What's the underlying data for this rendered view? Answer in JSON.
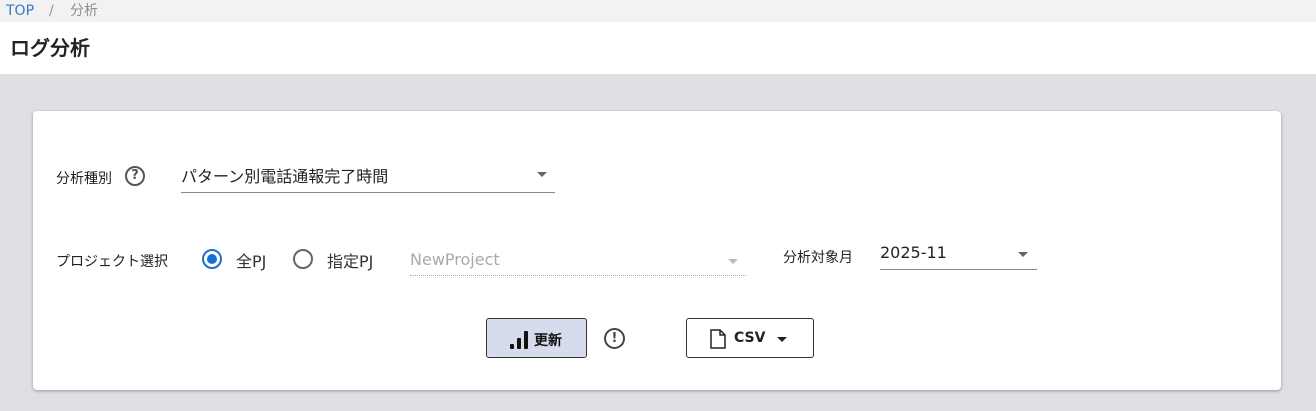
{
  "breadcrumb": {
    "home": "TOP",
    "separator": "/",
    "current": "分析"
  },
  "page": {
    "title": "ログ分析"
  },
  "form": {
    "analysis_type": {
      "label": "分析種別",
      "help_icon": "?",
      "value": "パターン別電話通報完了時間"
    },
    "project": {
      "label": "プロジェクト選択",
      "options": [
        {
          "label": "全PJ",
          "checked": true
        },
        {
          "label": "指定PJ",
          "checked": false
        }
      ],
      "select_value": "NewProject"
    },
    "month": {
      "label": "分析対象月",
      "value": "2025-11"
    }
  },
  "actions": {
    "update_label": "更新",
    "info_icon": "!",
    "csv_label": "CSV"
  },
  "colors": {
    "accent": "#1b6fd1",
    "link": "#2f7bc5",
    "update_button_bg": "#d6dcec"
  },
  "icons": {
    "help": "question-circle-icon",
    "update": "bar-chart-icon",
    "info": "exclamation-circle-icon",
    "csv": "file-icon",
    "dropdown": "caret-down-icon"
  }
}
